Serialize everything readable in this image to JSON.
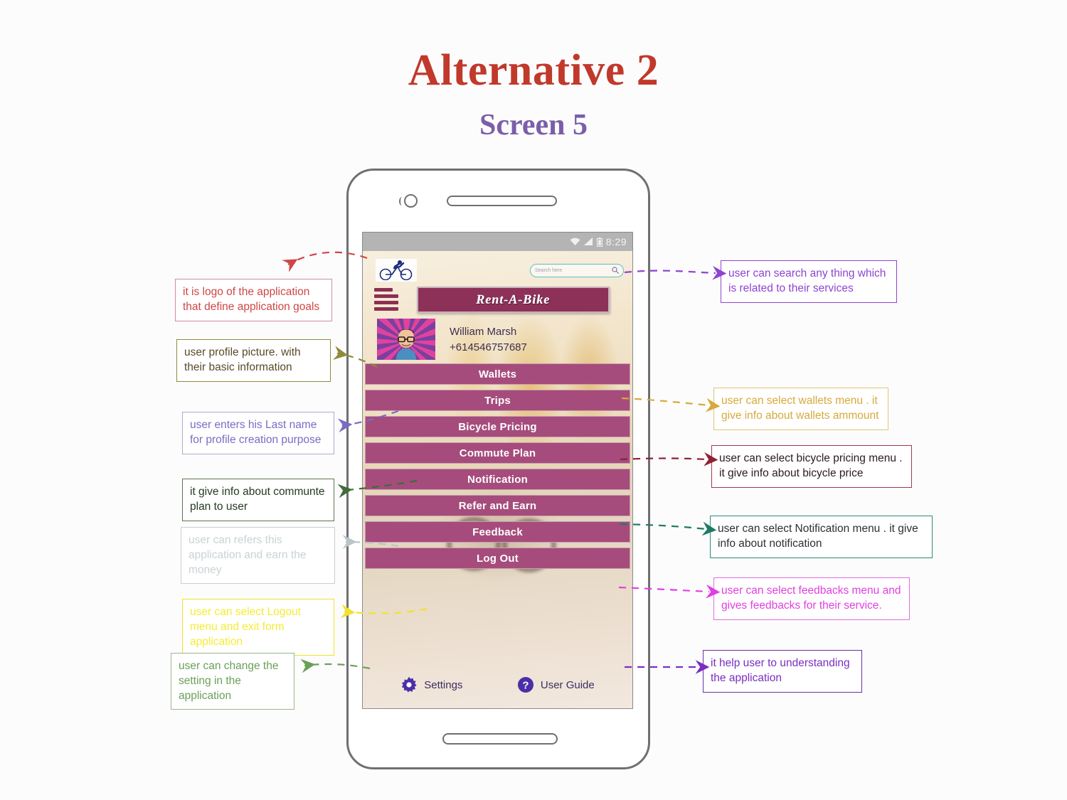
{
  "slide": {
    "title": "Alternative 2",
    "subtitle": "Screen 5",
    "title_color": "#c0392b",
    "subtitle_color": "#7b5ea7"
  },
  "phone": {
    "status_bar": {
      "time": "8:29",
      "icons": [
        "wifi-icon",
        "signal-icon",
        "battery-icon"
      ],
      "background_color": "#b4b4b4"
    },
    "header": {
      "logo_icon": "bicycle-logo-icon",
      "search": {
        "placeholder": "Search here",
        "icon": "search-icon",
        "border_color": "#59c0c8"
      },
      "hamburger_icon": "hamburger-menu-icon",
      "brand_title": "Rent-A-Bike",
      "brand_background": "#8d3159"
    },
    "profile": {
      "avatar_icon": "user-avatar",
      "name": "William Marsh",
      "phone": "+614546757687"
    },
    "menu_items": [
      {
        "label": "Wallets"
      },
      {
        "label": "Trips"
      },
      {
        "label": "Bicycle Pricing"
      },
      {
        "label": "Commute Plan"
      },
      {
        "label": "Notification"
      },
      {
        "label": "Refer and Earn"
      },
      {
        "label": "Feedback"
      },
      {
        "label": "Log Out"
      }
    ],
    "menu_button_color": "#a64c7c",
    "bottom_bar": [
      {
        "label": "Settings",
        "icon": "gear-icon"
      },
      {
        "label": "User Guide",
        "icon": "question-circle-icon"
      }
    ]
  },
  "annotations": {
    "left": [
      {
        "text": "it is logo of the application that define application goals",
        "color": "#cf4646"
      },
      {
        "text": "user profile picture.  with their basic information",
        "color": "#5a4a2a"
      },
      {
        "text": "user enters his Last name for profile creation purpose",
        "color": "#7b6bc4"
      },
      {
        "text": "it give info about communte plan to user",
        "color": "#243c1f"
      },
      {
        "text": "user can refers this application and earn the money",
        "color": "#c9d3d6"
      },
      {
        "text": "user can select Logout menu and exit form application",
        "color": "#f5ec33"
      },
      {
        "text": "user can change the setting in the application",
        "color": "#6aa05a"
      }
    ],
    "right": [
      {
        "text": "user can search any thing which is related to their services",
        "color": "#8e44d0"
      },
      {
        "text": "user can select wallets menu . it give info about wallets ammount",
        "color": "#d6aa3c"
      },
      {
        "text": "user can select bicycle pricing menu . it give info about bicycle price",
        "color": "#2b1a1f"
      },
      {
        "text": "user  can select Notification menu . it give info about notification",
        "color": "#2f2f35"
      },
      {
        "text": "user can select feedbacks menu  and gives feedbacks for their service.",
        "color": "#e040e0"
      },
      {
        "text": "it help user to understanding the application",
        "color": "#7a2fc0"
      }
    ]
  }
}
